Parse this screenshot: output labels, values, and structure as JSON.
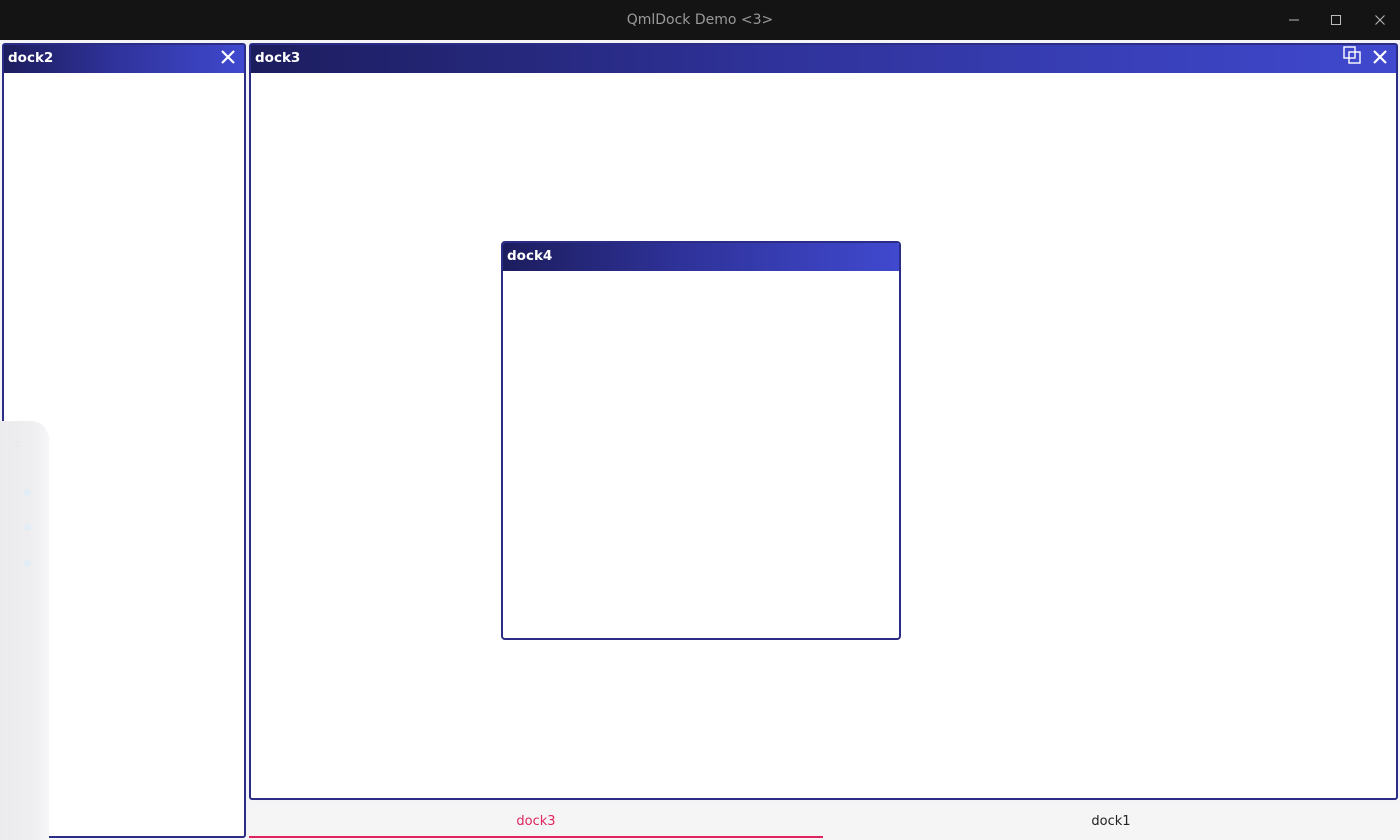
{
  "window": {
    "title": "QmlDock Demo <3>",
    "controls": {
      "minimize_icon": "minimize-icon",
      "maximize_icon": "maximize-icon",
      "close_icon": "close-icon"
    }
  },
  "docks": {
    "dock2": {
      "title": "dock2",
      "close_icon": "close-icon"
    },
    "dock3": {
      "title": "dock3",
      "float_icon": "float-icon",
      "close_icon": "close-icon"
    },
    "dock4": {
      "title": "dock4"
    }
  },
  "tabs": [
    {
      "label": "dock3",
      "active": true
    },
    {
      "label": "dock1",
      "active": false
    }
  ],
  "colors": {
    "header_dark": "#1c1d5e",
    "header_light": "#4049cf",
    "border": "#2a2c86",
    "active_tab": "#e0245e",
    "titlebar_bg": "#141414"
  }
}
